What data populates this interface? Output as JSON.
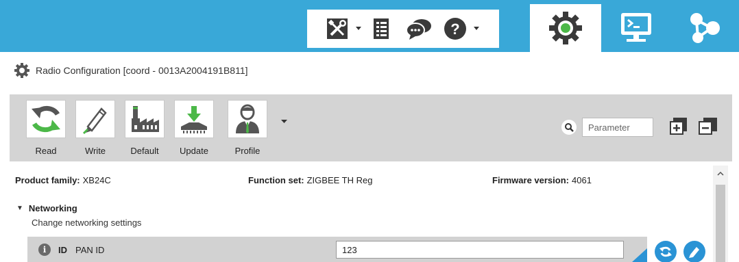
{
  "window": {
    "title": "Radio Configuration [coord - 0013A2004191B811]"
  },
  "topbar": {
    "tools": [
      {
        "icon": "tools-icon",
        "has_menu": true
      },
      {
        "icon": "document-icon",
        "has_menu": false
      },
      {
        "icon": "chat-icon",
        "has_menu": false
      },
      {
        "icon": "help-icon",
        "has_menu": true
      }
    ],
    "tabs": [
      {
        "icon": "gear-icon",
        "active": true
      },
      {
        "icon": "console-icon",
        "active": false
      },
      {
        "icon": "network-icon",
        "active": false
      }
    ]
  },
  "actions": {
    "items": [
      {
        "label": "Read",
        "icon": "read-icon"
      },
      {
        "label": "Write",
        "icon": "pencil-icon"
      },
      {
        "label": "Default",
        "icon": "factory-icon"
      },
      {
        "label": "Update",
        "icon": "update-icon"
      },
      {
        "label": "Profile",
        "icon": "profile-icon"
      }
    ],
    "search_placeholder": "Parameter"
  },
  "info": {
    "product_family_label": "Product family:",
    "product_family_value": "XB24C",
    "function_set_label": "Function set:",
    "function_set_value": "ZIGBEE TH Reg",
    "firmware_label": "Firmware version:",
    "firmware_value": "4061"
  },
  "section": {
    "title": "Networking",
    "description": "Change networking settings",
    "expanded": true
  },
  "params": [
    {
      "code": "ID",
      "name": "PAN ID",
      "value": "123"
    }
  ],
  "colors": {
    "topbar": "#39a8d8",
    "action_bar": "#d4d4d4",
    "accent_blue": "#2a93d5",
    "green": "#4cb848"
  }
}
